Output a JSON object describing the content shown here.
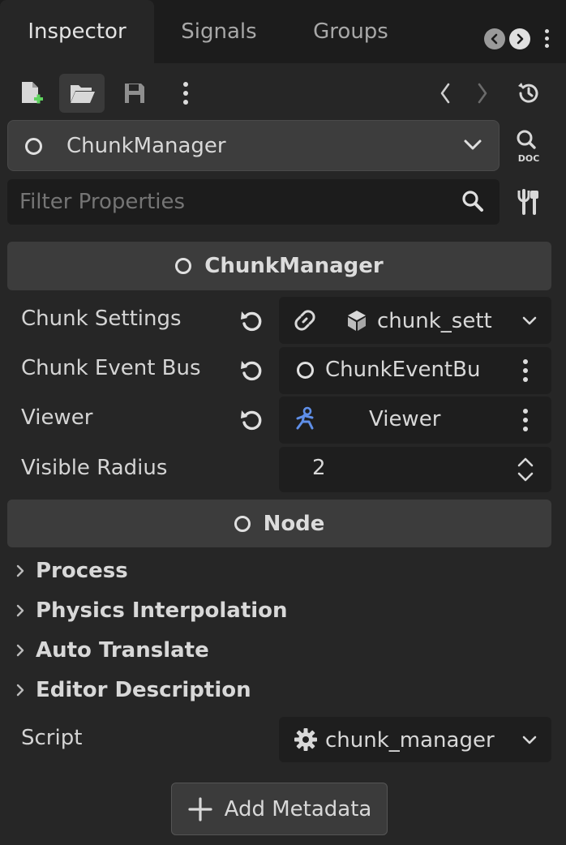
{
  "tabs": [
    {
      "label": "Inspector",
      "active": true
    },
    {
      "label": "Signals",
      "active": false
    },
    {
      "label": "Groups",
      "active": false
    }
  ],
  "toolbar": {
    "icons": [
      "new-resource-icon",
      "open-folder-icon",
      "save-icon",
      "more-options-icon"
    ],
    "history_icons": [
      "history-back-icon",
      "history-forward-icon",
      "recent-history-icon"
    ]
  },
  "object_selector": {
    "value": "ChunkManager"
  },
  "filter": {
    "placeholder": "Filter Properties"
  },
  "class_header": {
    "label": "ChunkManager"
  },
  "properties": [
    {
      "label": "Chunk Settings",
      "value": "chunk_sett"
    },
    {
      "label": "Chunk Event Bus",
      "value": "ChunkEventBu"
    },
    {
      "label": "Viewer",
      "value": "Viewer"
    },
    {
      "label": "Visible Radius",
      "value": "2"
    }
  ],
  "node_header": {
    "label": "Node"
  },
  "sections": [
    {
      "label": "Process"
    },
    {
      "label": "Physics Interpolation"
    },
    {
      "label": "Auto Translate"
    },
    {
      "label": "Editor Description"
    }
  ],
  "script": {
    "label": "Script",
    "value": "chunk_manager"
  },
  "add_metadata": {
    "label": "Add Metadata"
  },
  "colors": {
    "background": "#262626",
    "tab_bar": "#1c1c1c",
    "header": "#3c3c3c",
    "node_blue": "#5f8fe8",
    "add_green": "#5fd35f"
  }
}
